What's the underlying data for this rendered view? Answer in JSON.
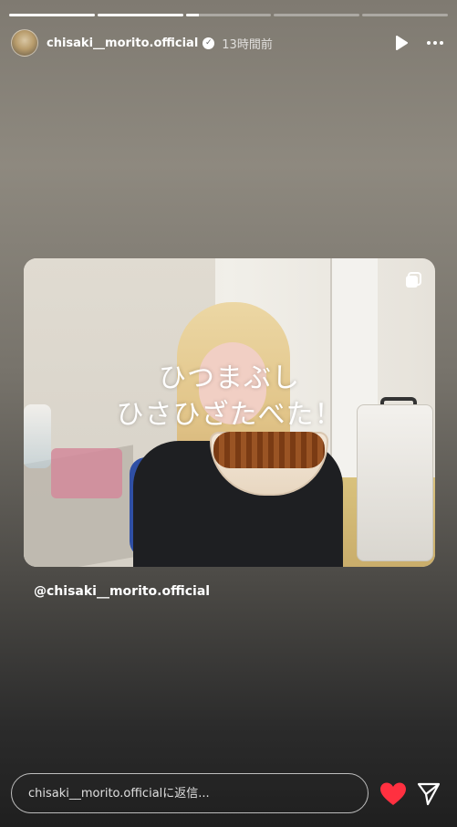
{
  "story": {
    "segments": [
      {
        "fill_fraction": 1
      },
      {
        "fill_fraction": 1
      },
      {
        "fill_fraction": 0.15
      },
      {
        "fill_fraction": 0
      },
      {
        "fill_fraction": 0
      }
    ]
  },
  "header": {
    "username": "chisaki__morito.official",
    "verified": true,
    "time": "13時間前",
    "icons": [
      "play-icon",
      "more-icon"
    ]
  },
  "post": {
    "caption_lines": [
      "ひつまぶし",
      "ひさひざたべた！"
    ]
  },
  "mention": "@chisaki__morito.official",
  "footer": {
    "reply_placeholder": "chisaki__morito.officialに返信...",
    "like_color": "#ff3040",
    "icons": [
      "heart-icon",
      "send-icon"
    ]
  }
}
